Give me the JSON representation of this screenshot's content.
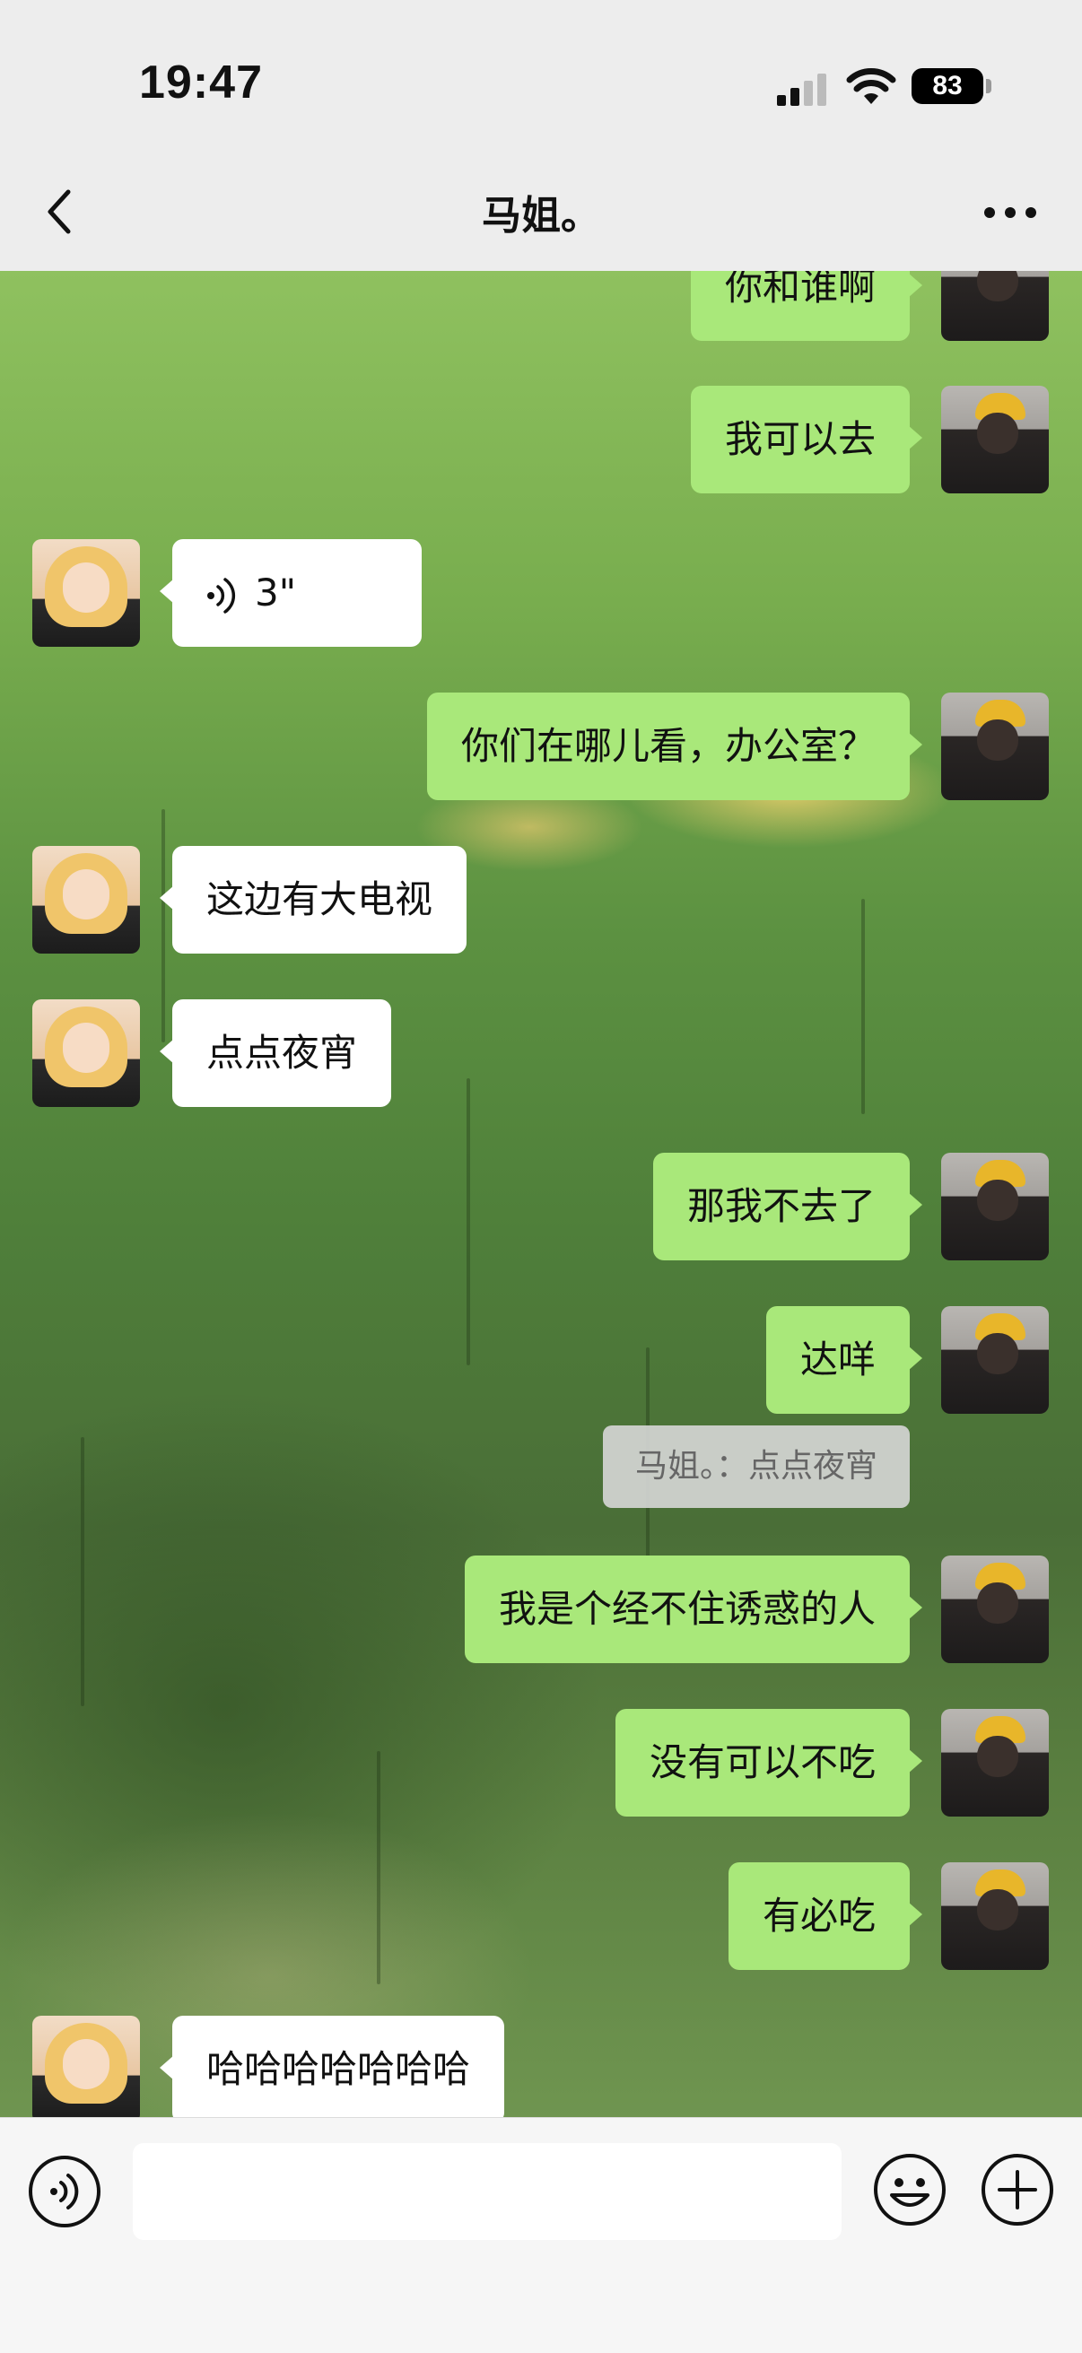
{
  "status_bar": {
    "time": "19:47",
    "battery": "83"
  },
  "header": {
    "title": "马姐。",
    "back_icon": "chevron-left-icon",
    "more_icon": "ellipsis-icon"
  },
  "messages": [
    {
      "side": "out",
      "text": "你和谁啊"
    },
    {
      "side": "out",
      "text": "我可以去"
    },
    {
      "side": "in",
      "type": "voice",
      "text": "3\""
    },
    {
      "side": "out",
      "text": "你们在哪儿看，办公室？"
    },
    {
      "side": "in",
      "text": "这边有大电视"
    },
    {
      "side": "in",
      "text": "点点夜宵"
    },
    {
      "side": "out",
      "text": "那我不去了"
    },
    {
      "side": "out",
      "text": "达咩"
    },
    {
      "side": "quote",
      "text": "马姐。：点点夜宵"
    },
    {
      "side": "out",
      "text": "我是个经不住诱惑的人"
    },
    {
      "side": "out",
      "text": "没有可以不吃"
    },
    {
      "side": "out",
      "text": "有必吃"
    },
    {
      "side": "in",
      "text": "哈哈哈哈哈哈哈"
    }
  ],
  "input_bar": {
    "voice_icon": "voice-wave-icon",
    "input_value": "",
    "emoji_icon": "smiley-icon",
    "plus_icon": "plus-circle-icon"
  },
  "colors": {
    "outgoing_bubble": "#a9e87a",
    "incoming_bubble": "#ffffff",
    "bar_background": "#ededed"
  }
}
